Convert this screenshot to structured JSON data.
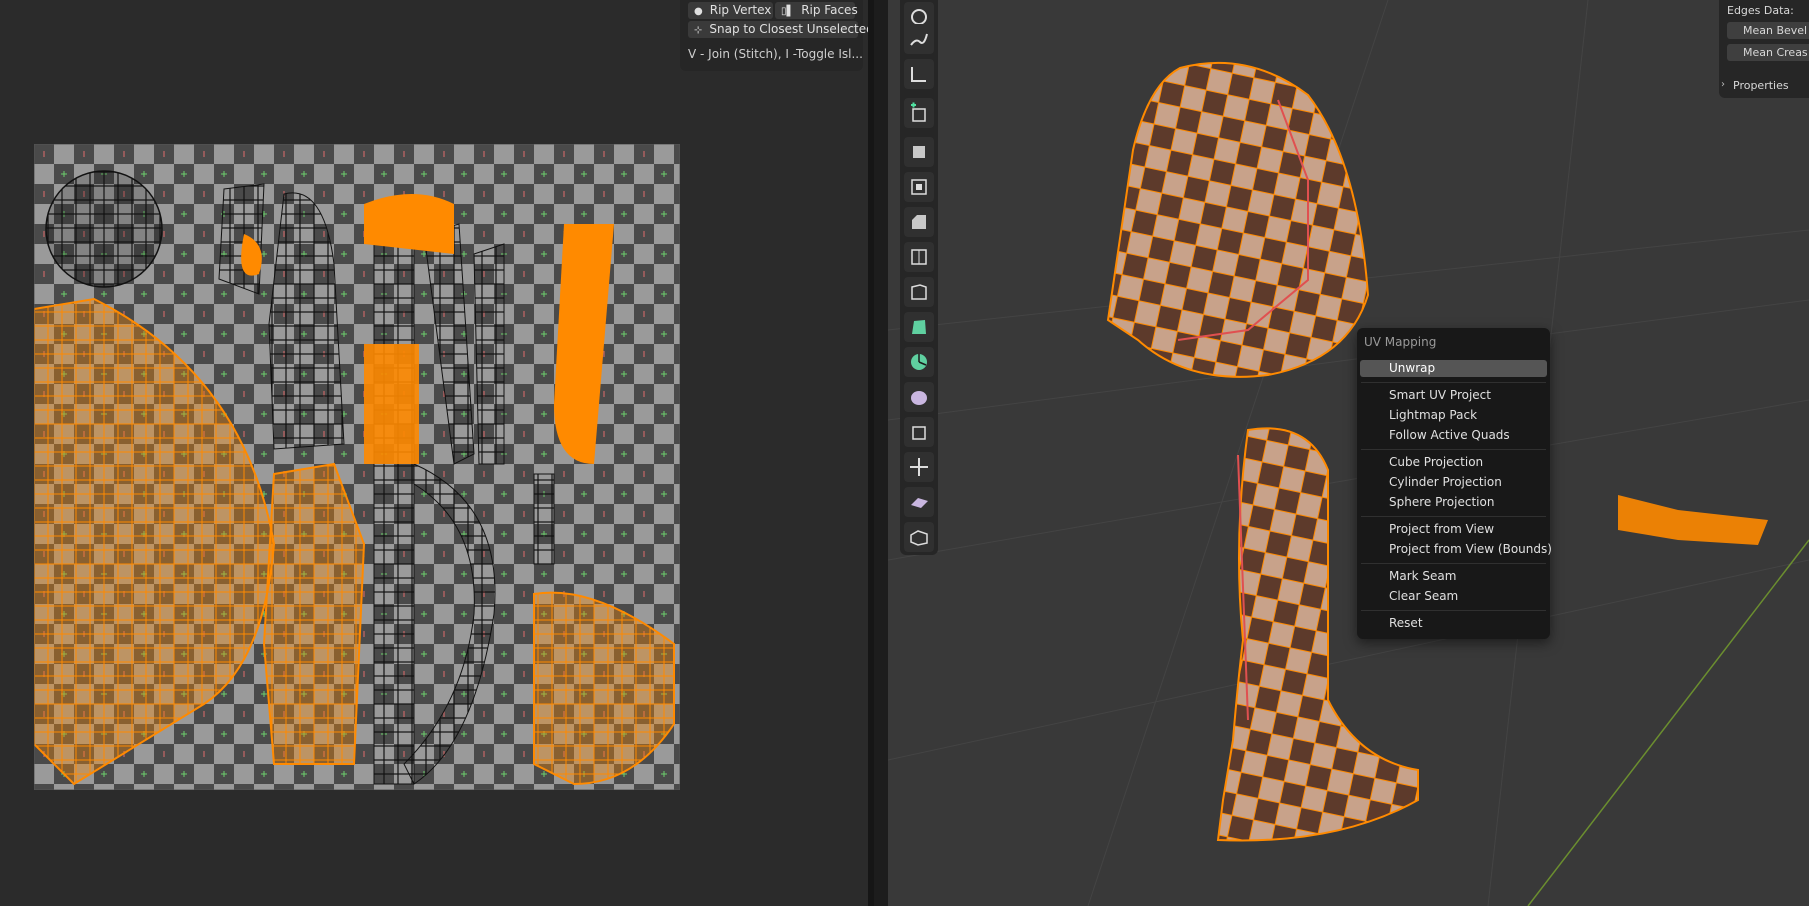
{
  "uv_editor": {
    "popover": {
      "rip_vertex": "Rip Vertex",
      "rip_faces": "Rip Faces",
      "snap_closest": "Snap to Closest Unselected",
      "hint": "V - Join (Stitch), I -Toggle Isl..."
    }
  },
  "viewport": {
    "toolbar": [
      "annotate-icon",
      "measure-icon",
      "add-cube-icon",
      "extrude-icon",
      "inset-icon",
      "bevel-icon",
      "loop-cut-icon",
      "knife-icon",
      "poly-build-icon",
      "spin-icon",
      "smooth-icon",
      "edge-slide-icon",
      "shrink-fatten-icon",
      "shear-icon",
      "rip-icon"
    ],
    "properties": {
      "edges_data_label": "Edges Data:",
      "mean_bevel": "Mean Bevel",
      "mean_crease": "Mean Creas",
      "properties_section": "Properties"
    },
    "context_menu": {
      "title": "UV Mapping",
      "items": {
        "unwrap": "Unwrap",
        "smart_uv": "Smart UV Project",
        "lightmap": "Lightmap Pack",
        "follow_quads": "Follow Active Quads",
        "cube": "Cube Projection",
        "cylinder": "Cylinder Projection",
        "sphere": "Sphere Projection",
        "proj_view": "Project from View",
        "proj_view_bounds": "Project from View (Bounds)",
        "mark_seam": "Mark Seam",
        "clear_seam": "Clear Seam",
        "reset": "Reset"
      },
      "highlighted": "Unwrap"
    }
  },
  "colors": {
    "selection_orange": "#ff8a00",
    "menu_bg": "#181818",
    "menu_highlight": "#555555",
    "active_tool": "#4772b3"
  }
}
